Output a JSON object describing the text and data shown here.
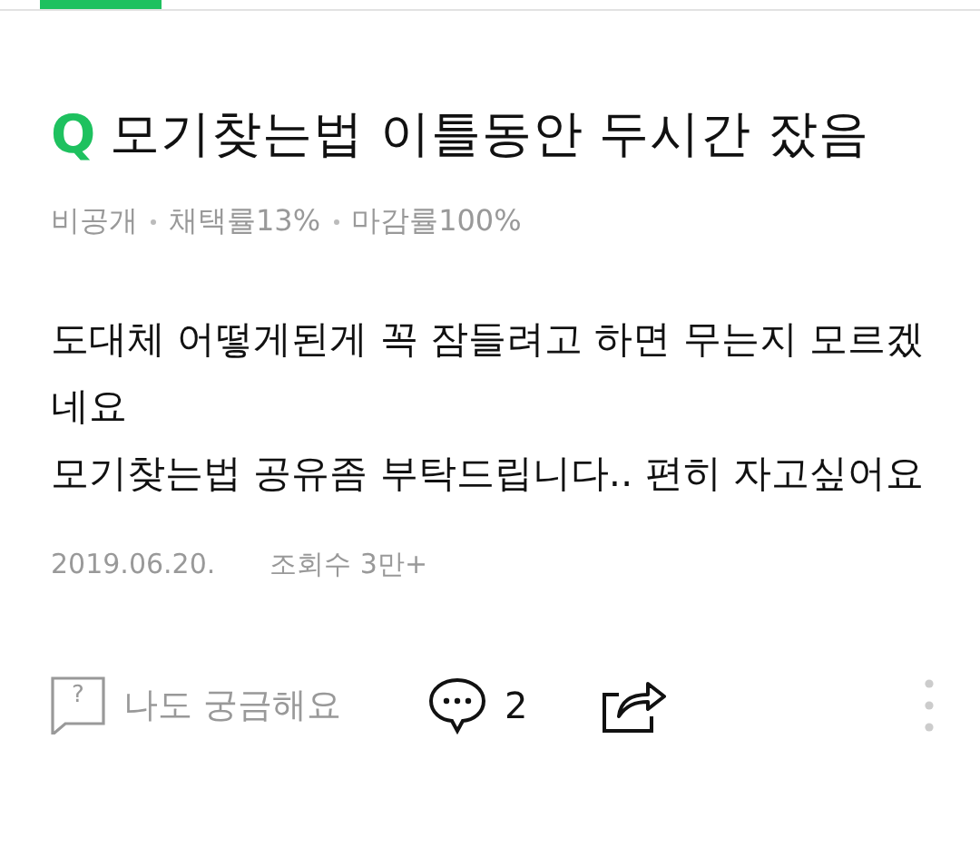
{
  "question": {
    "badge": "Q",
    "title": "모기찾는법 이틀동안 두시간 잤음",
    "meta": [
      "비공개",
      "채택률13%",
      "마감률100%"
    ],
    "body": [
      "도대체 어떻게된게 꼭 잠들려고 하면 무는지 모르겠네요",
      "모기찾는법 공유좀 부탁드립니다.. 편히 자고싶어요"
    ],
    "date": "2019.06.20.",
    "views": "조회수 3만+"
  },
  "actions": {
    "curious": {
      "icon_glyph": "?",
      "label": "나도 궁금해요"
    },
    "comments": {
      "count": "2"
    }
  }
}
